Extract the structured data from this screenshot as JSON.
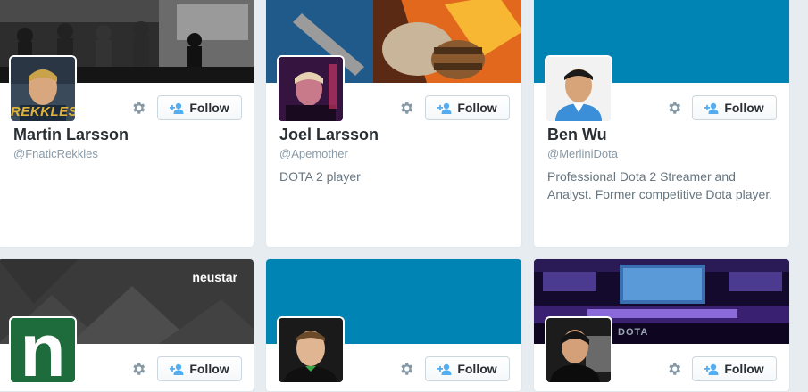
{
  "colors": {
    "accent": "#55acee",
    "blue_banner": "#0084b4",
    "name_text": "#292f33",
    "muted_text": "#8899a6"
  },
  "follow_label": "Follow",
  "cards": [
    {
      "name": "Martin Larsson",
      "handle": "@FnaticRekkles",
      "bio": "",
      "avatar_text": "REKKLES"
    },
    {
      "name": "Joel Larsson",
      "handle": "@Apemother",
      "bio": "DOTA 2 player",
      "avatar_text": ""
    },
    {
      "name": "Ben Wu",
      "handle": "@MerliniDota",
      "bio": "Professional Dota 2 Streamer and Analyst. Former competitive Dota player.",
      "avatar_text": ""
    },
    {
      "name": "",
      "handle": "",
      "bio": "",
      "banner_text": "neustar",
      "avatar_text": "n"
    },
    {
      "name": "",
      "handle": "",
      "bio": "",
      "avatar_text": ""
    },
    {
      "name": "",
      "handle": "",
      "bio": "",
      "banner_text": "DOTA",
      "avatar_text": ""
    }
  ]
}
